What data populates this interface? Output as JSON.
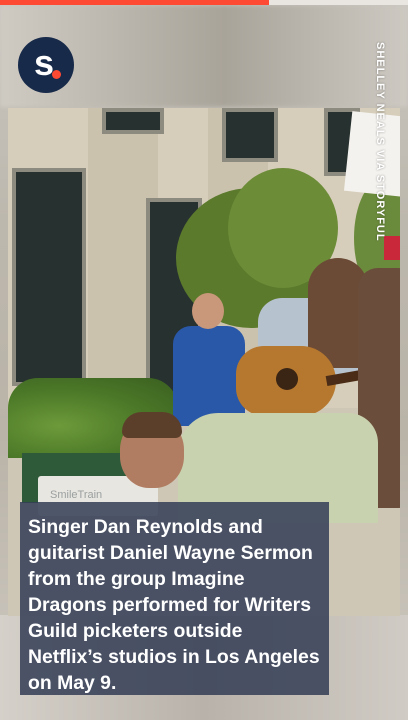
{
  "progress": {
    "fraction": 0.66,
    "color": "#ff4a33"
  },
  "logo": {
    "letter": "s",
    "icon": "brand-logo-icon",
    "bg_color": "#182a4a",
    "dot_color": "#ff4a33"
  },
  "credit": {
    "text": "SHELLEY NEALS VIA STORYFUL"
  },
  "scene": {
    "sign_text": "SmileTrain"
  },
  "caption": {
    "text": "Singer Dan Reynolds and guitarist Daniel Wayne Sermon from the group Imagine Dragons performed for Writers Guild picketers outside Netflix’s studios in Los Angeles on May 9.",
    "bg_color": "#343e56"
  }
}
